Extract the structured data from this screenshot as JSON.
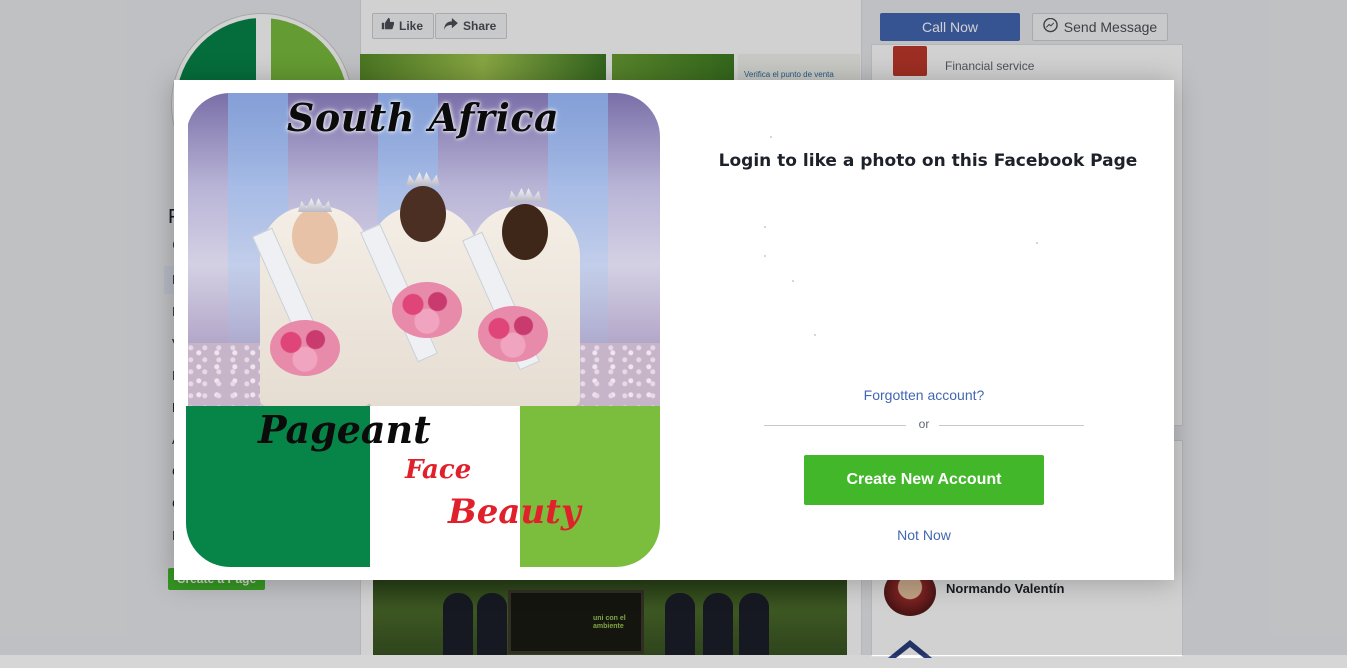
{
  "page": {
    "page_initial": "F",
    "nav_letters": [
      "@",
      "I",
      "I",
      "V",
      "I",
      "E",
      "A",
      "C",
      "C",
      "I"
    ],
    "create_page_label": "Create a Page",
    "like_label": "Like",
    "share_label": "Share",
    "photo_caption": "Verifica el punto de venta",
    "sign_text": "uni con el ambiente",
    "call_now_label": "Call Now",
    "send_message_label": "Send Message",
    "financial_service_label": "Financial service",
    "person_name": "Normando Valentín"
  },
  "dialog": {
    "promo": {
      "title": "South Africa",
      "line1": "Pageant",
      "line2": "Face",
      "line3": "Beauty",
      "colors": {
        "dark_green": "#078549",
        "light_green": "#7bbd3d",
        "red": "#e0202a"
      }
    },
    "heading": "Login to like a photo on this Facebook Page",
    "forgotten_account": "Forgotten account?",
    "or_label": "or",
    "create_account_label": "Create New Account",
    "not_now_label": "Not Now"
  },
  "colors": {
    "facebook_blue": "#4267b2",
    "create_green": "#42b72a",
    "page_bg": "#e9ebee"
  }
}
